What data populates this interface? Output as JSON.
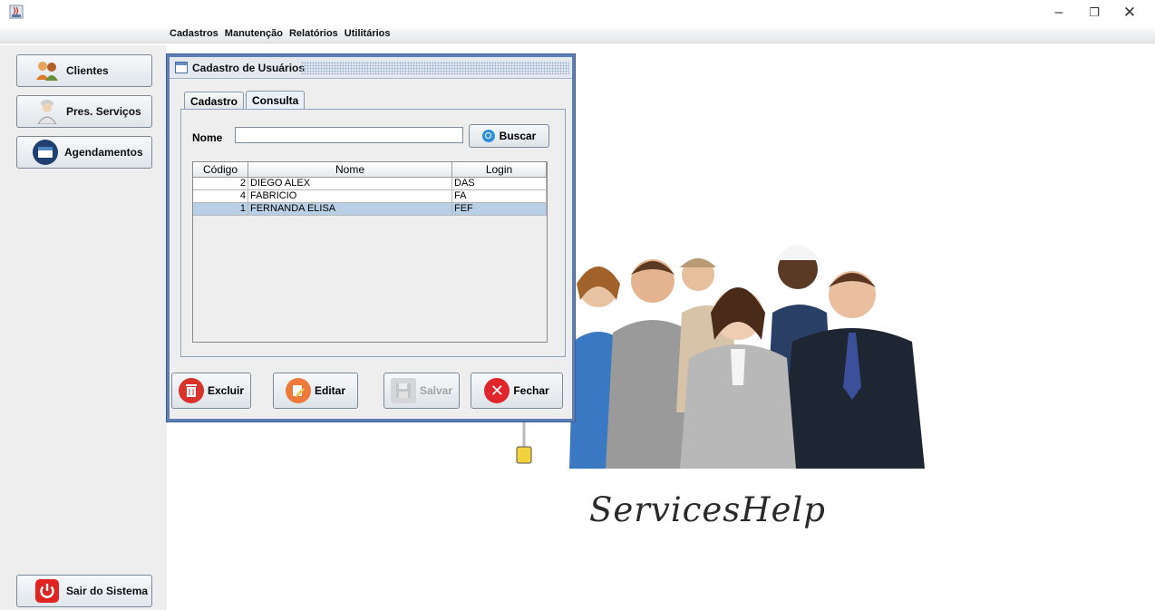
{
  "window": {
    "minimize": "–",
    "maximize": "❐",
    "close": "✕"
  },
  "menu": [
    "Cadastros",
    "Manutenção",
    "Relatórios",
    "Utilitários"
  ],
  "sidebar": {
    "items": [
      {
        "label": "Clientes",
        "icon": "clients-icon"
      },
      {
        "label": "Pres. Serviços",
        "icon": "service-provider-icon"
      },
      {
        "label": "Agendamentos",
        "icon": "calendar-icon"
      }
    ],
    "exit": {
      "label": "Sair do Sistema",
      "icon": "power-icon"
    }
  },
  "frame": {
    "title": "Cadastro de Usuários",
    "tabs": [
      "Cadastro",
      "Consulta"
    ],
    "active_tab": "Consulta",
    "search": {
      "label": "Nome",
      "value": "",
      "button": "Buscar"
    },
    "table": {
      "headers": [
        "Código",
        "Nome",
        "Login"
      ],
      "rows": [
        {
          "codigo": "2",
          "nome": "DIEGO ALEX",
          "login": "DAS"
        },
        {
          "codigo": "4",
          "nome": "FABRICIO",
          "login": "FA"
        },
        {
          "codigo": "1",
          "nome": "FERNANDA ELISA",
          "login": "FEF"
        }
      ]
    },
    "buttons": {
      "excluir": "Excluir",
      "editar": "Editar",
      "salvar": "Salvar",
      "fechar": "Fechar"
    }
  },
  "brand": "ServicesHelp",
  "colors": {
    "frame_border": "#5f7fb4",
    "selected_row": "#b8cfe5",
    "exit_red": "#e02424",
    "close_red": "#e0262c"
  }
}
